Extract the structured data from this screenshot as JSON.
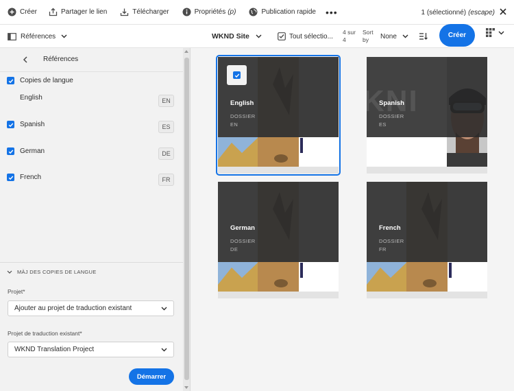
{
  "actionbar": {
    "create_label": "Créer",
    "share_label": "Partager le lien",
    "download_label": "Télécharger",
    "properties_label": "Propriétés",
    "properties_shortcut": "(p)",
    "publish_label": "Publication rapide",
    "more_label": "•••",
    "selection_text": "1 (sélectionné)",
    "selection_escape": "(escape)"
  },
  "subbar": {
    "rail_label": "Références",
    "site_label": "WKND Site",
    "select_all_label": "Tout sélectio...",
    "count_line1": "4 sur",
    "count_line2": "4",
    "sort_label_line1": "Sort",
    "sort_label_line2": "by",
    "sort_value": "None",
    "create_button": "Créer"
  },
  "rail": {
    "title": "Références",
    "language_copies_label": "Copies de langue",
    "languages": [
      {
        "name": "English",
        "code": "EN",
        "checked": false
      },
      {
        "name": "Spanish",
        "code": "ES",
        "checked": true
      },
      {
        "name": "German",
        "code": "DE",
        "checked": true
      },
      {
        "name": "French",
        "code": "FR",
        "checked": true
      }
    ],
    "update_section_label": "MÀJ DES COPIES DE LANGUE",
    "project_label": "Projet*",
    "project_value": "Ajouter au projet de traduction existant",
    "existing_project_label": "Projet de traduction existant*",
    "existing_project_value": "WKND Translation Project",
    "start_button": "Démarrer"
  },
  "cards": [
    {
      "name": "English",
      "type": "DOSSIER",
      "code": "EN",
      "selected": true,
      "preview": "collage"
    },
    {
      "name": "Spanish",
      "type": "DOSSIER",
      "code": "ES",
      "selected": false,
      "preview": "portrait",
      "watermark": "KNI"
    },
    {
      "name": "German",
      "type": "DOSSIER",
      "code": "DE",
      "selected": false,
      "preview": "collage"
    },
    {
      "name": "French",
      "type": "DOSSIER",
      "code": "FR",
      "selected": false,
      "preview": "collage"
    }
  ],
  "colors": {
    "accent": "#1473e6",
    "overlay": "#282828",
    "rail_bg": "#f2f2f2",
    "content_bg": "#f4f4f4"
  }
}
